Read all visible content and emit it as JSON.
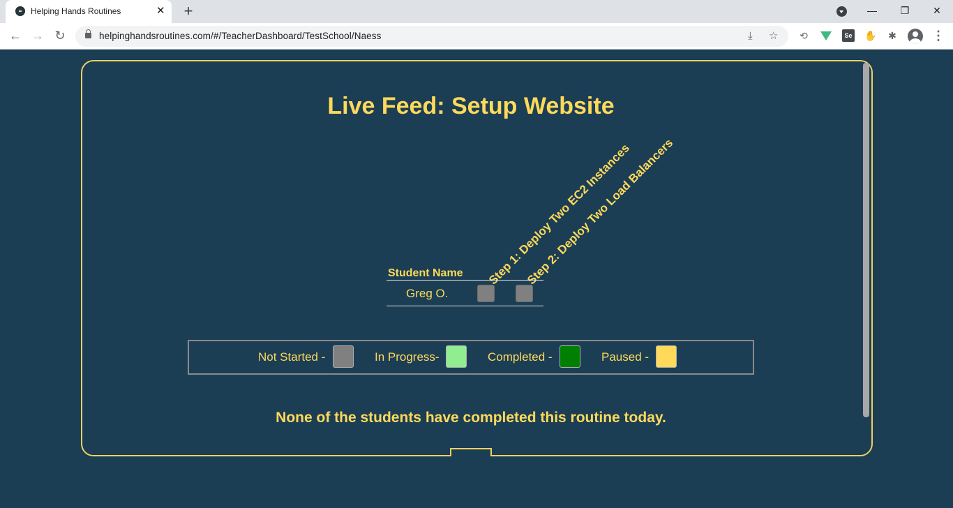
{
  "browser": {
    "tab_title": "Helping Hands Routines",
    "tab_close": "✕",
    "new_tab": "+",
    "url": "helpinghandsroutines.com/#/TeacherDashboard/TestSchool/Naess",
    "back": "←",
    "forward": "→",
    "reload": "↻",
    "minimize": "—",
    "restore": "❐",
    "close": "✕",
    "menu": "⋮"
  },
  "page": {
    "title": "Live Feed: Setup Website",
    "table": {
      "name_header": "Student Name",
      "step_headers": [
        "Step 1: Deploy Two EC2 Instances",
        "Step 2: Deploy Two Load Balancers"
      ],
      "rows": [
        {
          "name": "Greg O.",
          "statuses": [
            "not-started",
            "not-started"
          ]
        }
      ]
    },
    "legend": {
      "items": [
        {
          "label": "Not Started -",
          "color": "#808080"
        },
        {
          "label": "In Progress-",
          "color": "#90ee90"
        },
        {
          "label": "Completed -",
          "color": "#008000"
        },
        {
          "label": "Paused -",
          "color": "#ffd95a"
        }
      ]
    },
    "footer_message": "None of the students have completed this routine today."
  }
}
